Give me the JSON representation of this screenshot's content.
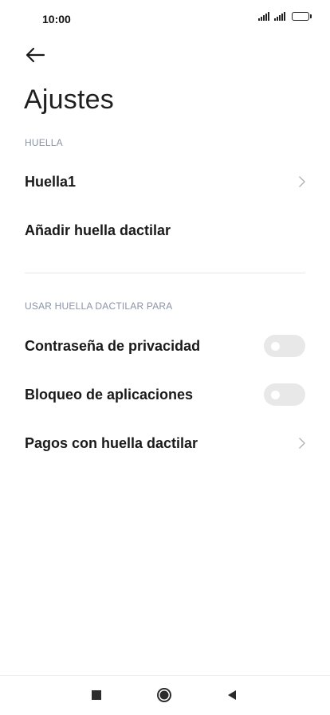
{
  "status_bar": {
    "time": "10:00"
  },
  "header": {
    "title": "Ajustes"
  },
  "sections": {
    "fingerprint": {
      "header": "HUELLA",
      "items": [
        {
          "label": "Huella1",
          "control": "chevron"
        },
        {
          "label": "Añadir huella dactilar",
          "control": "none"
        }
      ]
    },
    "use_for": {
      "header": "USAR HUELLA DACTILAR PARA",
      "items": [
        {
          "label": "Contraseña de privacidad",
          "control": "toggle",
          "enabled": false
        },
        {
          "label": "Bloqueo de aplicaciones",
          "control": "toggle",
          "enabled": false
        },
        {
          "label": "Pagos con huella dactilar",
          "control": "chevron"
        }
      ]
    }
  },
  "icons": {
    "back": "arrow-left-icon",
    "chevron": "chevron-right-icon",
    "nav_recents": "square-icon",
    "nav_home": "circle-icon",
    "nav_back": "triangle-left-icon"
  },
  "colors": {
    "section_header": "#8a94a6",
    "toggle_off": "#e8e8e8",
    "divider": "#e6e6e6"
  }
}
